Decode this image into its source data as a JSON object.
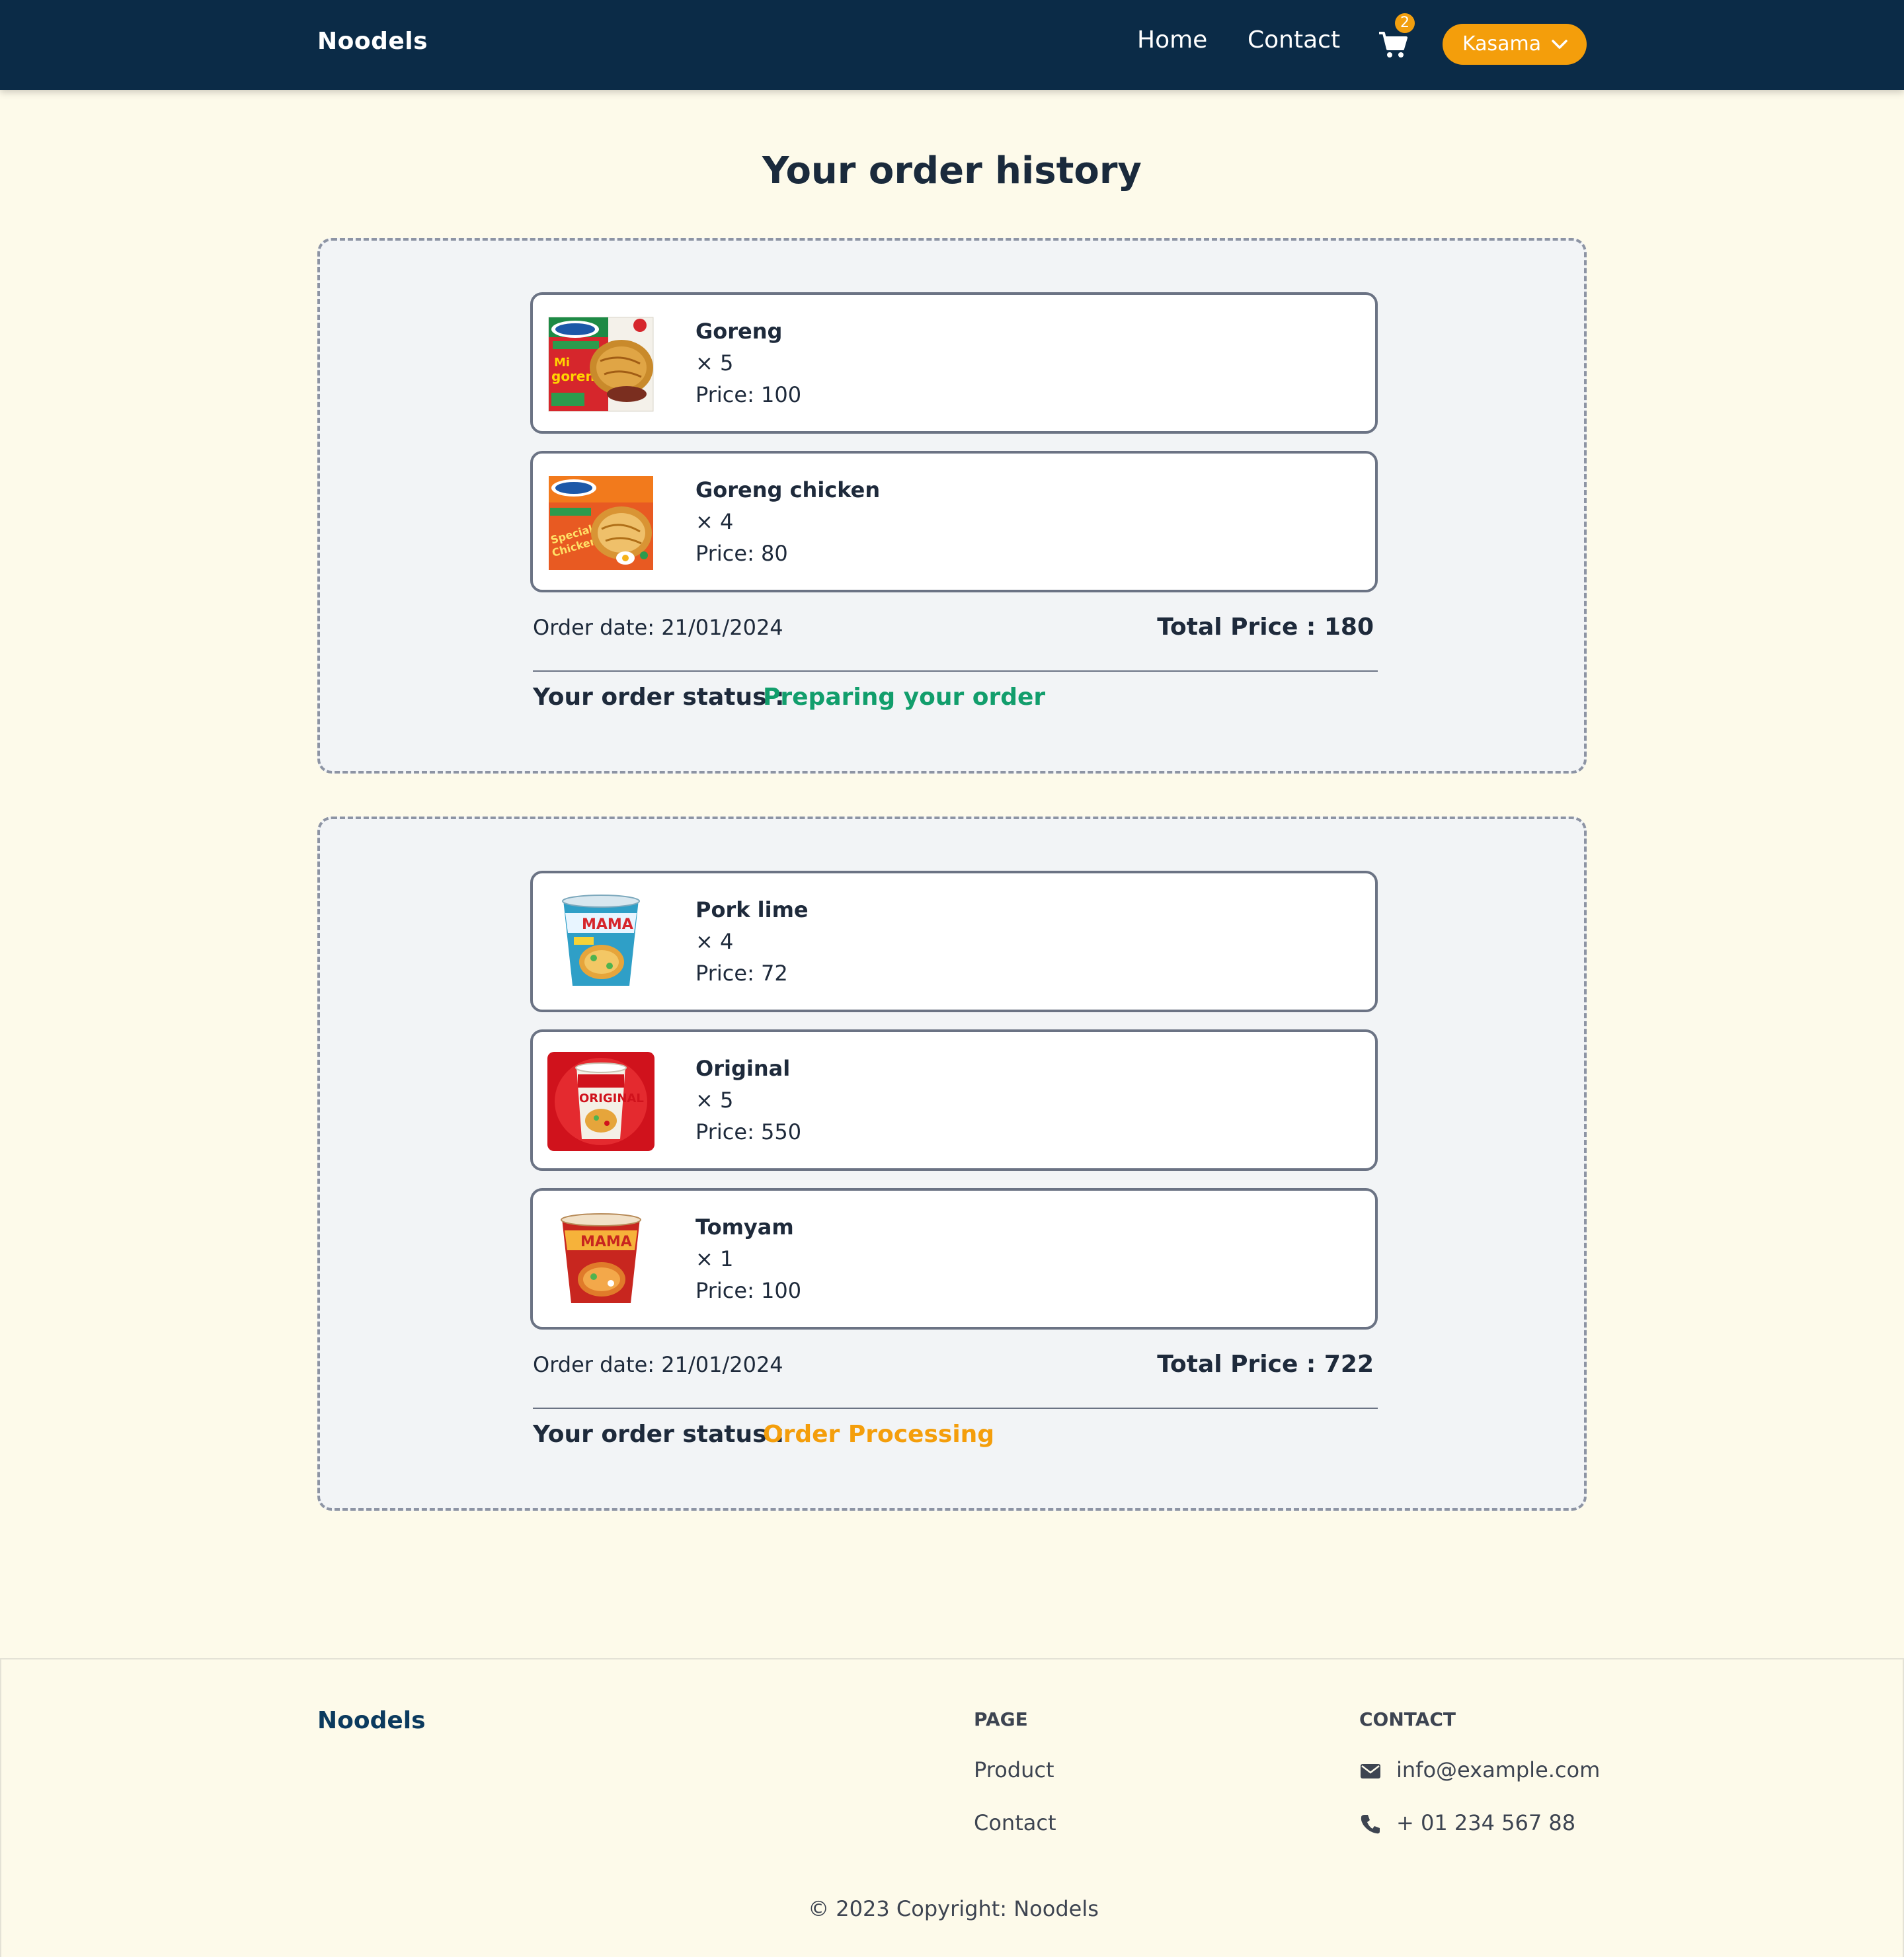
{
  "navbar": {
    "brand": "Noodels",
    "links": [
      {
        "label": "Home"
      },
      {
        "label": "Contact"
      }
    ],
    "cart_count": "2",
    "cart_icon": "shopping-cart-icon",
    "user_label": "Kasama",
    "user_icon": "chevron-down-icon",
    "bg_color": "#0b2b47",
    "accent_color": "#f49e0b"
  },
  "page": {
    "title": "Your order history"
  },
  "orders": [
    {
      "items": [
        {
          "name": "Goreng",
          "qty": "× 5",
          "price": "Price: 100"
        },
        {
          "name": "Goreng chicken",
          "qty": "× 4",
          "price": "Price: 80"
        }
      ],
      "order_date": "Order date: 21/01/2024",
      "total_price": "Total Price : 180",
      "status_label": "Your order status :",
      "status_value": "Preparing your order",
      "status_color": "#129e6c"
    },
    {
      "items": [
        {
          "name": "Pork lime",
          "qty": "× 4",
          "price": "Price: 72"
        },
        {
          "name": "Original",
          "qty": "× 5",
          "price": "Price: 550"
        },
        {
          "name": "Tomyam",
          "qty": "× 1",
          "price": "Price: 100"
        }
      ],
      "order_date": "Order date: 21/01/2024",
      "total_price": "Total Price : 722",
      "status_label": "Your order status :",
      "status_value": "Order Processing",
      "status_color": "#f49e0b"
    }
  ],
  "footer": {
    "brand": "Noodels",
    "page_heading": "PAGE",
    "page_links": [
      {
        "label": "Product"
      },
      {
        "label": "Contact"
      }
    ],
    "contact_heading": "CONTACT",
    "email": "info@example.com",
    "phone": "+ 01 234 567 88",
    "email_icon": "envelope-icon",
    "phone_icon": "phone-icon",
    "copyright": "© 2023 Copyright: Noodels"
  }
}
